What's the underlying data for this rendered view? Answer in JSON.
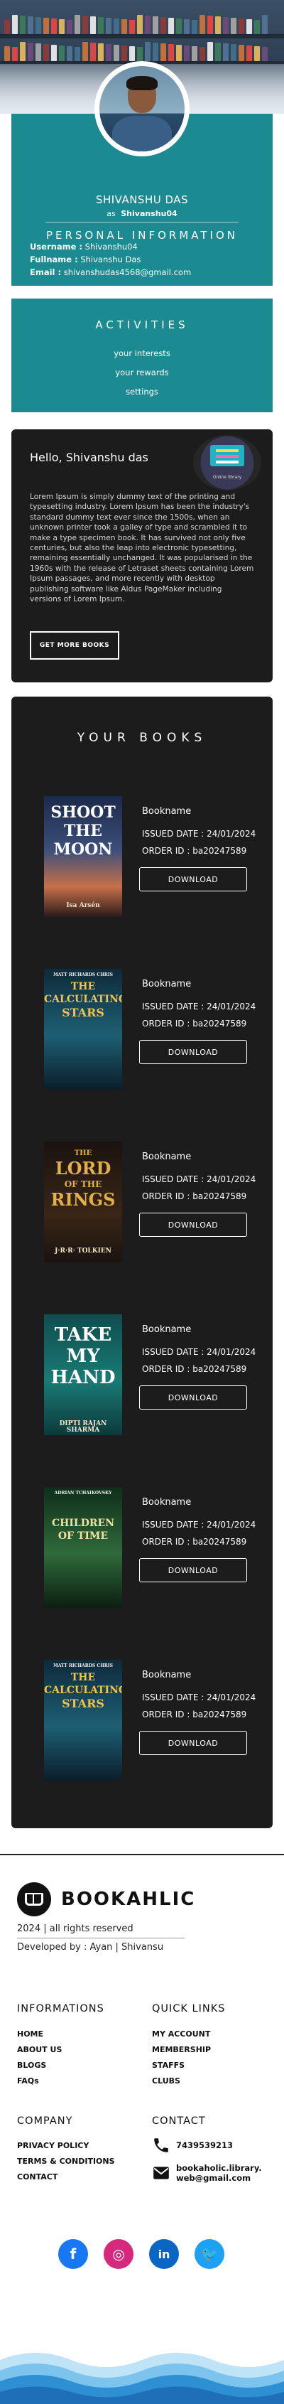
{
  "profile": {
    "name": "SHIVANSHU DAS",
    "as_prefix": "as",
    "as_username": "Shivanshu04",
    "section_title": "PERSONAL INFORMATION",
    "fields": [
      {
        "label": "Username :",
        "value": "Shivanshu04"
      },
      {
        "label": "Fullname :",
        "value": "Shivanshu Das"
      },
      {
        "label": "Email :",
        "value": "shivanshudas4568@gmail.com"
      }
    ]
  },
  "activities": {
    "title": "ACTIVITIES",
    "items": [
      "your interests",
      "your rewards",
      "settings"
    ]
  },
  "hello": {
    "greeting": "Hello, Shivanshu das",
    "illustration_caption": "Online library",
    "body": "Lorem Ipsum is simply dummy text of the printing and typesetting industry. Lorem Ipsum has been the industry's standard dummy text ever since the 1500s, when an unknown printer took a galley of type and scrambled it to make a type specimen book. It has survived not only five centuries, but also the leap into electronic typesetting, remaining essentially unchanged. It was popularised in the 1960s with the release of Letraset sheets containing Lorem Ipsum passages, and more recently with desktop publishing software like Aldus PageMaker including versions of Lorem Ipsum.",
    "button": "GET MORE BOOKS"
  },
  "books": {
    "title": "YOUR BOOKS",
    "items": [
      {
        "name": "Bookname",
        "issued": "ISSUED DATE : 24/01/2024",
        "order": "ORDER ID : ba20247589",
        "button": "DOWNLOAD",
        "cover": {
          "lines": [
            "SHOOT",
            "THE",
            "MOON"
          ],
          "author": "Isa Arsén"
        }
      },
      {
        "name": "Bookname",
        "issued": "ISSUED DATE : 24/01/2024",
        "order": "ORDER ID : ba20247589",
        "button": "DOWNLOAD",
        "cover": {
          "top": "MATT RICHARDS CHRIS",
          "lines": [
            "THE",
            "CALCULATING",
            "STARS"
          ],
          "author": ""
        }
      },
      {
        "name": "Bookname",
        "issued": "ISSUED DATE : 24/01/2024",
        "order": "ORDER ID : ba20247589",
        "button": "DOWNLOAD",
        "cover": {
          "lines": [
            "THE",
            "LORD",
            "OF THE",
            "RINGS"
          ],
          "author": "J·R·R· TOLKIEN"
        }
      },
      {
        "name": "Bookname",
        "issued": "ISSUED DATE : 24/01/2024",
        "order": "ORDER ID : ba20247589",
        "button": "DOWNLOAD",
        "cover": {
          "lines": [
            "TAKE",
            "MY",
            "HAND"
          ],
          "author": "DIPTI RAJAN SHARMA"
        }
      },
      {
        "name": "Bookname",
        "issued": "ISSUED DATE : 24/01/2024",
        "order": "ORDER ID : ba20247589",
        "button": "DOWNLOAD",
        "cover": {
          "top": "ADRIAN TCHAIKOVSKY",
          "lines": [
            "CHILDREN",
            "OF TIME"
          ],
          "author": ""
        }
      },
      {
        "name": "Bookname",
        "issued": "ISSUED DATE : 24/01/2024",
        "order": "ORDER ID : ba20247589",
        "button": "DOWNLOAD",
        "cover": {
          "top": "MATT RICHARDS CHRIS",
          "lines": [
            "THE",
            "CALCULATING",
            "STARS"
          ],
          "author": ""
        }
      }
    ]
  },
  "footer": {
    "brand": "BOOKAHLIC",
    "rights": "2024 | all rights reserved",
    "developed_by": "Developed by : Ayan | Shivansu",
    "informations": {
      "title": "INFORMATIONS",
      "links": [
        "HOME",
        "ABOUT US",
        "BLOGS",
        "FAQs"
      ]
    },
    "quick_links": {
      "title": "QUICK LINKS",
      "links": [
        "MY ACCOUNT",
        "MEMBERSHIP",
        "STAFFS",
        "CLUBS"
      ]
    },
    "company": {
      "title": "COMPANY",
      "links": [
        "PRIVACY POLICY",
        "TERMS & CONDITIONS",
        "CONTACT"
      ]
    },
    "contact": {
      "title": "CONTACT",
      "phone": "7439539213",
      "email": "bookaholic.library.web@gmail.com"
    },
    "social": [
      {
        "icon": "facebook-icon",
        "glyph": "f",
        "color": "#1877f2"
      },
      {
        "icon": "instagram-icon",
        "glyph": "◎",
        "color": "#d6297c"
      },
      {
        "icon": "linkedin-icon",
        "glyph": "in",
        "color": "#0a66c2"
      },
      {
        "icon": "twitter-icon",
        "glyph": "🐦",
        "color": "#1da1f2"
      }
    ]
  },
  "colors": {
    "teal": "#1b8a91",
    "dark_card": "#1c1c1c",
    "wave": "#2f8fd3"
  }
}
